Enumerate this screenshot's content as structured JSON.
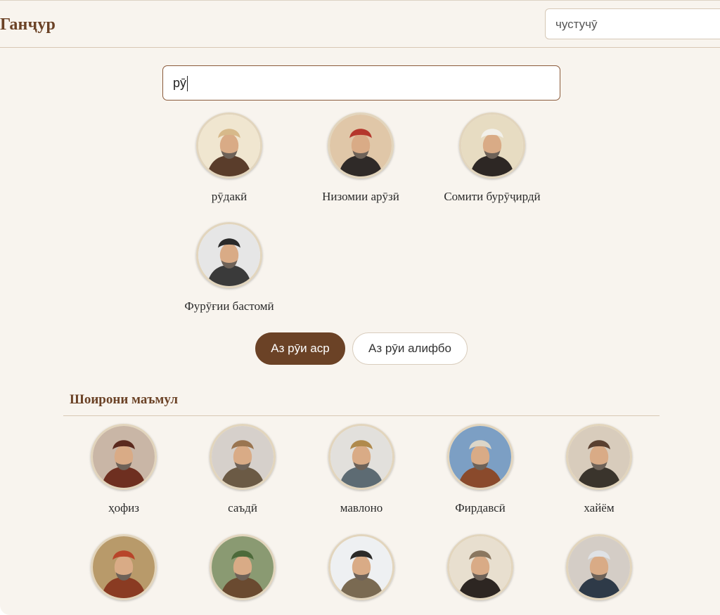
{
  "header": {
    "logo": "Ганҷур",
    "search_value": "чустучӯ"
  },
  "search": {
    "value": "рӯ"
  },
  "results": [
    {
      "name": "рӯдакӣ",
      "bg": "#f0e6d0",
      "robe": "#5a3d2b",
      "hat": "#d7b98a"
    },
    {
      "name": "Низомии арӯзӣ",
      "bg": "#e0c7a8",
      "robe": "#2f2a28",
      "hat": "#b5372c"
    },
    {
      "name": "Сомити бурӯҷирдӣ",
      "bg": "#e7dcc2",
      "robe": "#2d2724",
      "hat": "#f2f0ea"
    },
    {
      "name": "Фурӯғии бастомӣ",
      "bg": "#e6e6e6",
      "robe": "#3a3a3a",
      "hat": "#2a2a2a"
    }
  ],
  "sort_buttons": {
    "by_era": "Аз рӯи аср",
    "by_alphabet": "Аз рӯи алифбо"
  },
  "popular": {
    "title": "Шоирони маъмул",
    "poets": [
      {
        "name": "ҳофиз",
        "bg": "#c9b6a6",
        "robe": "#6e2f20",
        "hat": "#5b2a1e"
      },
      {
        "name": "саъдӣ",
        "bg": "#d6d0cb",
        "robe": "#6b5a45",
        "hat": "#9a7550"
      },
      {
        "name": "мавлоно",
        "bg": "#e2e0dc",
        "robe": "#5d6b73",
        "hat": "#b08a4c"
      },
      {
        "name": "Фирдавсӣ",
        "bg": "#7c9fc4",
        "robe": "#8a4a2c",
        "hat": "#dcd6c8"
      },
      {
        "name": "хайём",
        "bg": "#d8ccbc",
        "robe": "#3a342c",
        "hat": "#5a4030"
      },
      {
        "name": "",
        "bg": "#b89a6a",
        "robe": "#8a3b22",
        "hat": "#b8452a"
      },
      {
        "name": "",
        "bg": "#8a9a72",
        "robe": "#6a4a30",
        "hat": "#4d6a3a"
      },
      {
        "name": "",
        "bg": "#eef0f2",
        "robe": "#7a6a52",
        "hat": "#2c2a28"
      },
      {
        "name": "",
        "bg": "#e8dfcf",
        "robe": "#2d2622",
        "hat": "#8a7760"
      },
      {
        "name": "",
        "bg": "#d4cdc6",
        "robe": "#2e3a48",
        "hat": "#dfe2e6"
      }
    ]
  }
}
